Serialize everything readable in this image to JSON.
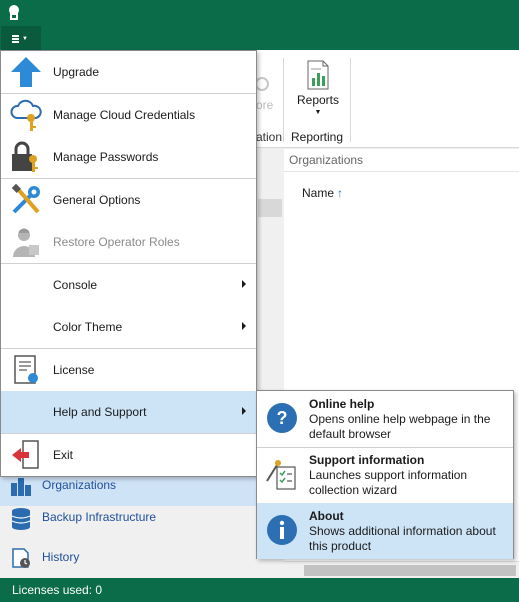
{
  "app": {
    "main_menu_label": "Main menu"
  },
  "ribbon": {
    "ghost_button_label": "ore",
    "ghost_group_label": "ation",
    "reports_label": "Reports",
    "reporting_group_label": "Reporting"
  },
  "content": {
    "title": "Organizations",
    "name_column": "Name",
    "sort_indicator": "↑"
  },
  "nav": {
    "organizations": "Organizations",
    "backup_infrastructure": "Backup Infrastructure",
    "history": "History"
  },
  "status": {
    "licenses": "Licenses used: 0"
  },
  "menu": {
    "upgrade": "Upgrade",
    "manage_cloud_credentials": "Manage Cloud Credentials",
    "manage_passwords": "Manage Passwords",
    "general_options": "General Options",
    "restore_operator_roles": "Restore Operator Roles",
    "console": "Console",
    "color_theme": "Color Theme",
    "license": "License",
    "help_and_support": "Help and Support",
    "exit": "Exit"
  },
  "submenu": {
    "online_help_title": "Online help",
    "online_help_desc": "Opens online help webpage in the default browser",
    "support_info_title": "Support information",
    "support_info_desc": "Launches support information collection wizard",
    "about_title": "About",
    "about_desc": "Shows additional information about this product"
  },
  "colors": {
    "brand_green": "#0b6c4a",
    "highlight_blue": "#cde4f7",
    "nav_text_blue": "#1e4f9c"
  }
}
